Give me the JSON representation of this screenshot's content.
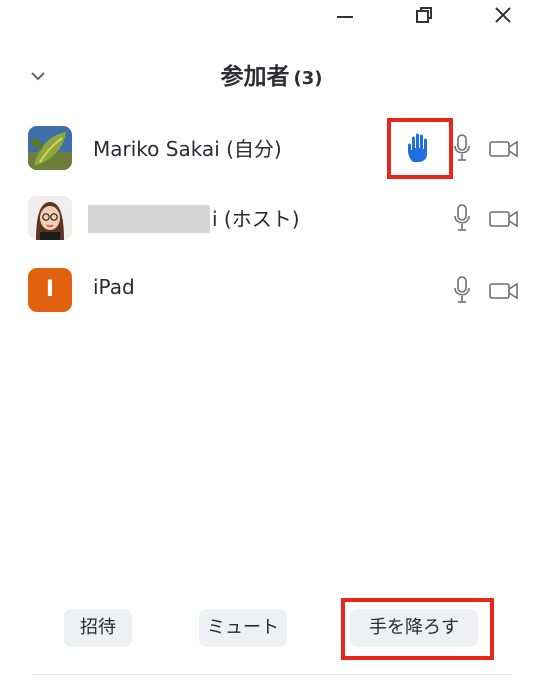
{
  "window": {
    "minimize_icon": "minimize-icon",
    "restore_icon": "restore-icon",
    "close_icon": "close-icon"
  },
  "header": {
    "title": "参加者",
    "count": "(3)",
    "collapse_icon": "chevron-down-icon"
  },
  "participants": [
    {
      "name": "Mariko Sakai (自分)",
      "avatar": "leaf-photo",
      "hand_raised": true,
      "mic_icon": "mic-icon",
      "camera_icon": "video-camera-icon"
    },
    {
      "name": "i (ホスト)",
      "avatar": "cartoon-avatar",
      "hand_raised": false,
      "mic_icon": "mic-icon",
      "camera_icon": "video-camera-icon"
    },
    {
      "name": "iPad",
      "avatar_letter": "I",
      "avatar_color": "#e0620f",
      "hand_raised": false,
      "mic_icon": "mic-icon",
      "camera_icon": "video-camera-icon"
    }
  ],
  "footer": {
    "invite_label": "招待",
    "mute_label": "ミュート",
    "lower_hand_label": "手を降ろす"
  },
  "colors": {
    "hand": "#1f6fe0",
    "highlight": "#e8261c",
    "button_bg": "#eef0f4"
  }
}
